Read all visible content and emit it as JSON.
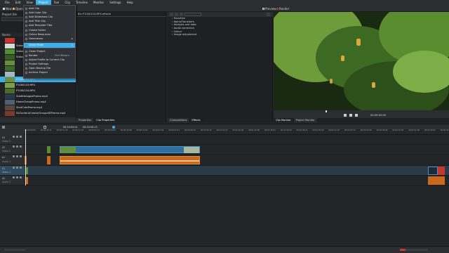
{
  "menubar": {
    "items": [
      "File",
      "Edit",
      "View",
      "Project",
      "Tool",
      "Clip",
      "Timeline",
      "Monitor",
      "Settings",
      "Help"
    ],
    "active_index": 3
  },
  "toolbar": {
    "new": "New",
    "open": "Open",
    "save": "Save",
    "undo": "Undo",
    "redo": "Redo",
    "preview": "Preview",
    "render": "Render"
  },
  "project_bin": {
    "title": "Project Bin",
    "column_header": "Name",
    "clips": [
      {
        "name": "",
        "thumb": "#c8372d"
      },
      {
        "name": "Subscri",
        "thumb": "#d9d9d9"
      },
      {
        "name": "Subscri",
        "thumb": "#4f8f2f"
      },
      {
        "name": "Subscri",
        "thumb": "#355e2a"
      },
      {
        "name": "",
        "thumb": "#6a8c3a"
      },
      {
        "name": "",
        "thumb": "#3a6b2a"
      },
      {
        "name": "",
        "thumb": "#a9b8c0"
      },
      {
        "name": "P1000152.MP4",
        "thumb": "#6e8f3e",
        "selected": true
      },
      {
        "name": "P1000153.MP4",
        "thumb": "#7aa04a"
      },
      {
        "name": "P1000154.MP4",
        "thumb": "#4a6a2a"
      },
      {
        "name": "SubtitleLogosPromo.mp4",
        "thumb": "#2a3a4a"
      },
      {
        "name": "HomeCheapPromo.mp4",
        "thumb": "#506070"
      },
      {
        "name": "ShotCutePromo.mp4",
        "thumb": "#5a4a3a"
      },
      {
        "name": "SVContentCreatorGroupVIDPromo.mp4",
        "thumb": "#7a3a2a"
      }
    ]
  },
  "project_menu": {
    "items": [
      {
        "label": "Add Clip",
        "icon": "add-icon"
      },
      {
        "label": "Add Color Clip",
        "icon": "color-icon"
      },
      {
        "label": "Add Slideshow Clip",
        "icon": "slideshow-icon"
      },
      {
        "label": "Add Title Clip",
        "icon": "title-icon"
      },
      {
        "label": "Add Template Title",
        "icon": "template-icon"
      },
      {
        "label": "Create Folder",
        "icon": "folder-icon"
      },
      {
        "label": "Online Resources",
        "icon": "globe-icon"
      },
      {
        "label": "Generators",
        "icon": "generator-icon",
        "submenu": true
      },
      {
        "sep": true
      },
      {
        "label": "Clean Mode",
        "icon": "clean-icon",
        "submenu": true,
        "highlight": true
      },
      {
        "sep": true
      },
      {
        "label": "Clean Project",
        "icon": "broom-icon"
      },
      {
        "label": "Render",
        "icon": "render-icon",
        "shortcut": "Ctrl+Return"
      },
      {
        "label": "Adjust Profile to Current Clip",
        "icon": "profile-icon"
      },
      {
        "label": "Project Settings",
        "icon": "settings-icon"
      },
      {
        "label": "Open Backup File",
        "icon": "backup-icon"
      },
      {
        "label": "Archive Project",
        "icon": "archive-icon"
      }
    ]
  },
  "clip_properties": {
    "title": "Bin P1000153.MP4 effects",
    "tabs": [
      "Properties",
      "Clip Properties"
    ],
    "active_tab": 1
  },
  "effects": {
    "categories": [
      "Favorites",
      "Alpha/Transform",
      "Analysis and data",
      "Audio correction",
      "Colour",
      "Image adjustment"
    ],
    "tabs": [
      "Compositions",
      "Effects"
    ],
    "active_tab": 1
  },
  "monitor": {
    "timecode": "00:00:02:00",
    "tabs": [
      "Clip Monitor",
      "Project Monitor"
    ],
    "active_tab": 0
  },
  "timeline_bar": {
    "timecode": "00:10:50:01",
    "duration": "00:10:50:13"
  },
  "ruler": {
    "ticks": [
      "00:00:00:00",
      "00:00:05:21",
      "00:00:11:18",
      "00:00:17:15",
      "00:00:23:12",
      "00:00:29:09",
      "00:00:35:06",
      "00:00:41:03",
      "00:00:47:00",
      "00:00:52:21",
      "00:00:58:18",
      "00:01:04:15",
      "00:01:10:12",
      "00:01:16:09",
      "00:01:22:06",
      "00:01:28:03",
      "00:01:34:00",
      "00:01:39:21",
      "00:01:45:18",
      "00:01:51:15",
      "00:01:57:12",
      "00:02:03:09",
      "00:02:09:06",
      "00:02:15:03",
      "00:02:21:00",
      "00:02:26:21",
      "00:02:32:18"
    ]
  },
  "tracks": [
    {
      "label": "V3",
      "sub": "Video 3"
    },
    {
      "label": "V2",
      "sub": "Video 2"
    },
    {
      "label": "A1",
      "sub": "Audio 1"
    },
    {
      "label": "V1",
      "sub": "Video 1"
    },
    {
      "label": "A2",
      "sub": "Audio 2"
    }
  ],
  "colors": {
    "accent": "#3daee9",
    "video_clip": "#2f6f9f",
    "audio_clip": "#c8691e",
    "bg": "#232629"
  }
}
